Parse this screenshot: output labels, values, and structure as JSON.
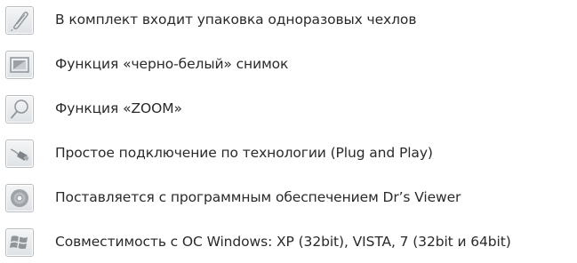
{
  "features": [
    {
      "icon": "disposable-cover-icon",
      "text": "В комплект входит упаковка  одноразовых чехлов"
    },
    {
      "icon": "monochrome-photo-icon",
      "text": "Функция «черно-белый» снимок"
    },
    {
      "icon": "zoom-magnifier-icon",
      "text": "Функция «ZOOM»"
    },
    {
      "icon": "usb-plug-icon",
      "text": "Простое подключение по технологии (Plug and Play)"
    },
    {
      "icon": "software-disc-icon",
      "text": "Поставляется с программным обеспечением Dr’s Viewer"
    },
    {
      "icon": "windows-logo-icon",
      "text": "Совместимость с ОС Windows: XP (32bit), VISTA, 7 (32bit и 64bit)"
    }
  ],
  "colors": {
    "icon_gray": "#8f9499",
    "text": "#2a2a2a"
  }
}
